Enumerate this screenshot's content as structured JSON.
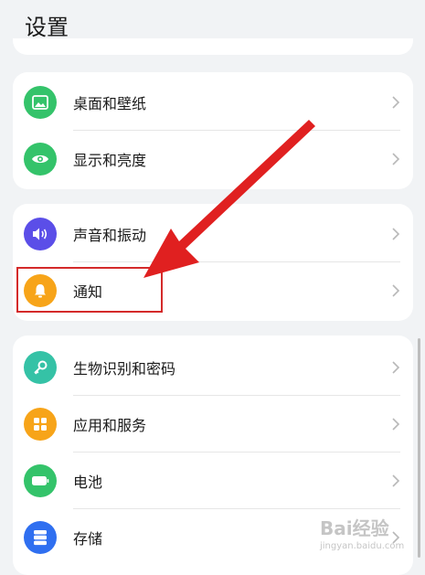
{
  "page": {
    "title": "设置"
  },
  "groups": [
    {
      "items": [
        {
          "label": "桌面和壁纸",
          "icon": "wallpaper-icon",
          "color": "#34c36a"
        },
        {
          "label": "显示和亮度",
          "icon": "eye-icon",
          "color": "#34c36a"
        }
      ]
    },
    {
      "items": [
        {
          "label": "声音和振动",
          "icon": "speaker-icon",
          "color": "#5b4ee8"
        },
        {
          "label": "通知",
          "icon": "bell-icon",
          "color": "#f7a419"
        }
      ]
    },
    {
      "items": [
        {
          "label": "生物识别和密码",
          "icon": "key-icon",
          "color": "#35c2a6"
        },
        {
          "label": "应用和服务",
          "icon": "grid-icon",
          "color": "#f7a419"
        },
        {
          "label": "电池",
          "icon": "battery-icon",
          "color": "#34c36a"
        },
        {
          "label": "存储",
          "icon": "storage-icon",
          "color": "#2f6ff0"
        }
      ]
    }
  ],
  "annotation": {
    "highlight_color": "#d42a2a",
    "arrow_color": "#e02020"
  },
  "watermark": {
    "text": "Bai经验",
    "url": "jingyan.baidu.com"
  }
}
